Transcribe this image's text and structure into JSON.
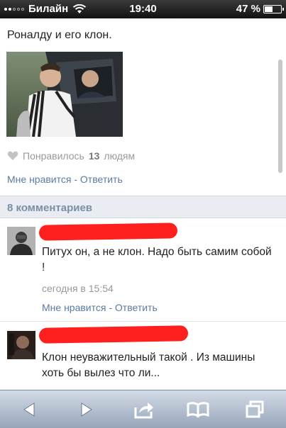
{
  "status_bar": {
    "carrier": "Билайн",
    "time": "19:40",
    "battery": "47 %"
  },
  "post": {
    "title": "Роналду и его клон.",
    "likes_prefix": "Понравилось",
    "likes_count": "13",
    "likes_suffix": "людям",
    "like_action": "Мне нравится",
    "separator": "-",
    "reply_action": "Ответить"
  },
  "comments_header": "8 комментариев",
  "comments": [
    {
      "text": "Питух он, а не клон. Надо быть самим собой !",
      "date": "сегодня в 15:54",
      "like_action": "Мне нравится",
      "separator": "-",
      "reply_action": "Ответить"
    },
    {
      "text": "Клон неуважительный такой . Из машины хоть бы вылез что ли..."
    }
  ],
  "toolbar": {
    "icons": [
      "back-arrow-icon",
      "forward-arrow-icon",
      "share-icon",
      "bookmarks-icon",
      "tabs-icon"
    ]
  },
  "colors": {
    "link": "#5b7aa3",
    "muted": "#999999",
    "redaction": "#ff1f1f",
    "section_bg": "#e9edf2"
  }
}
